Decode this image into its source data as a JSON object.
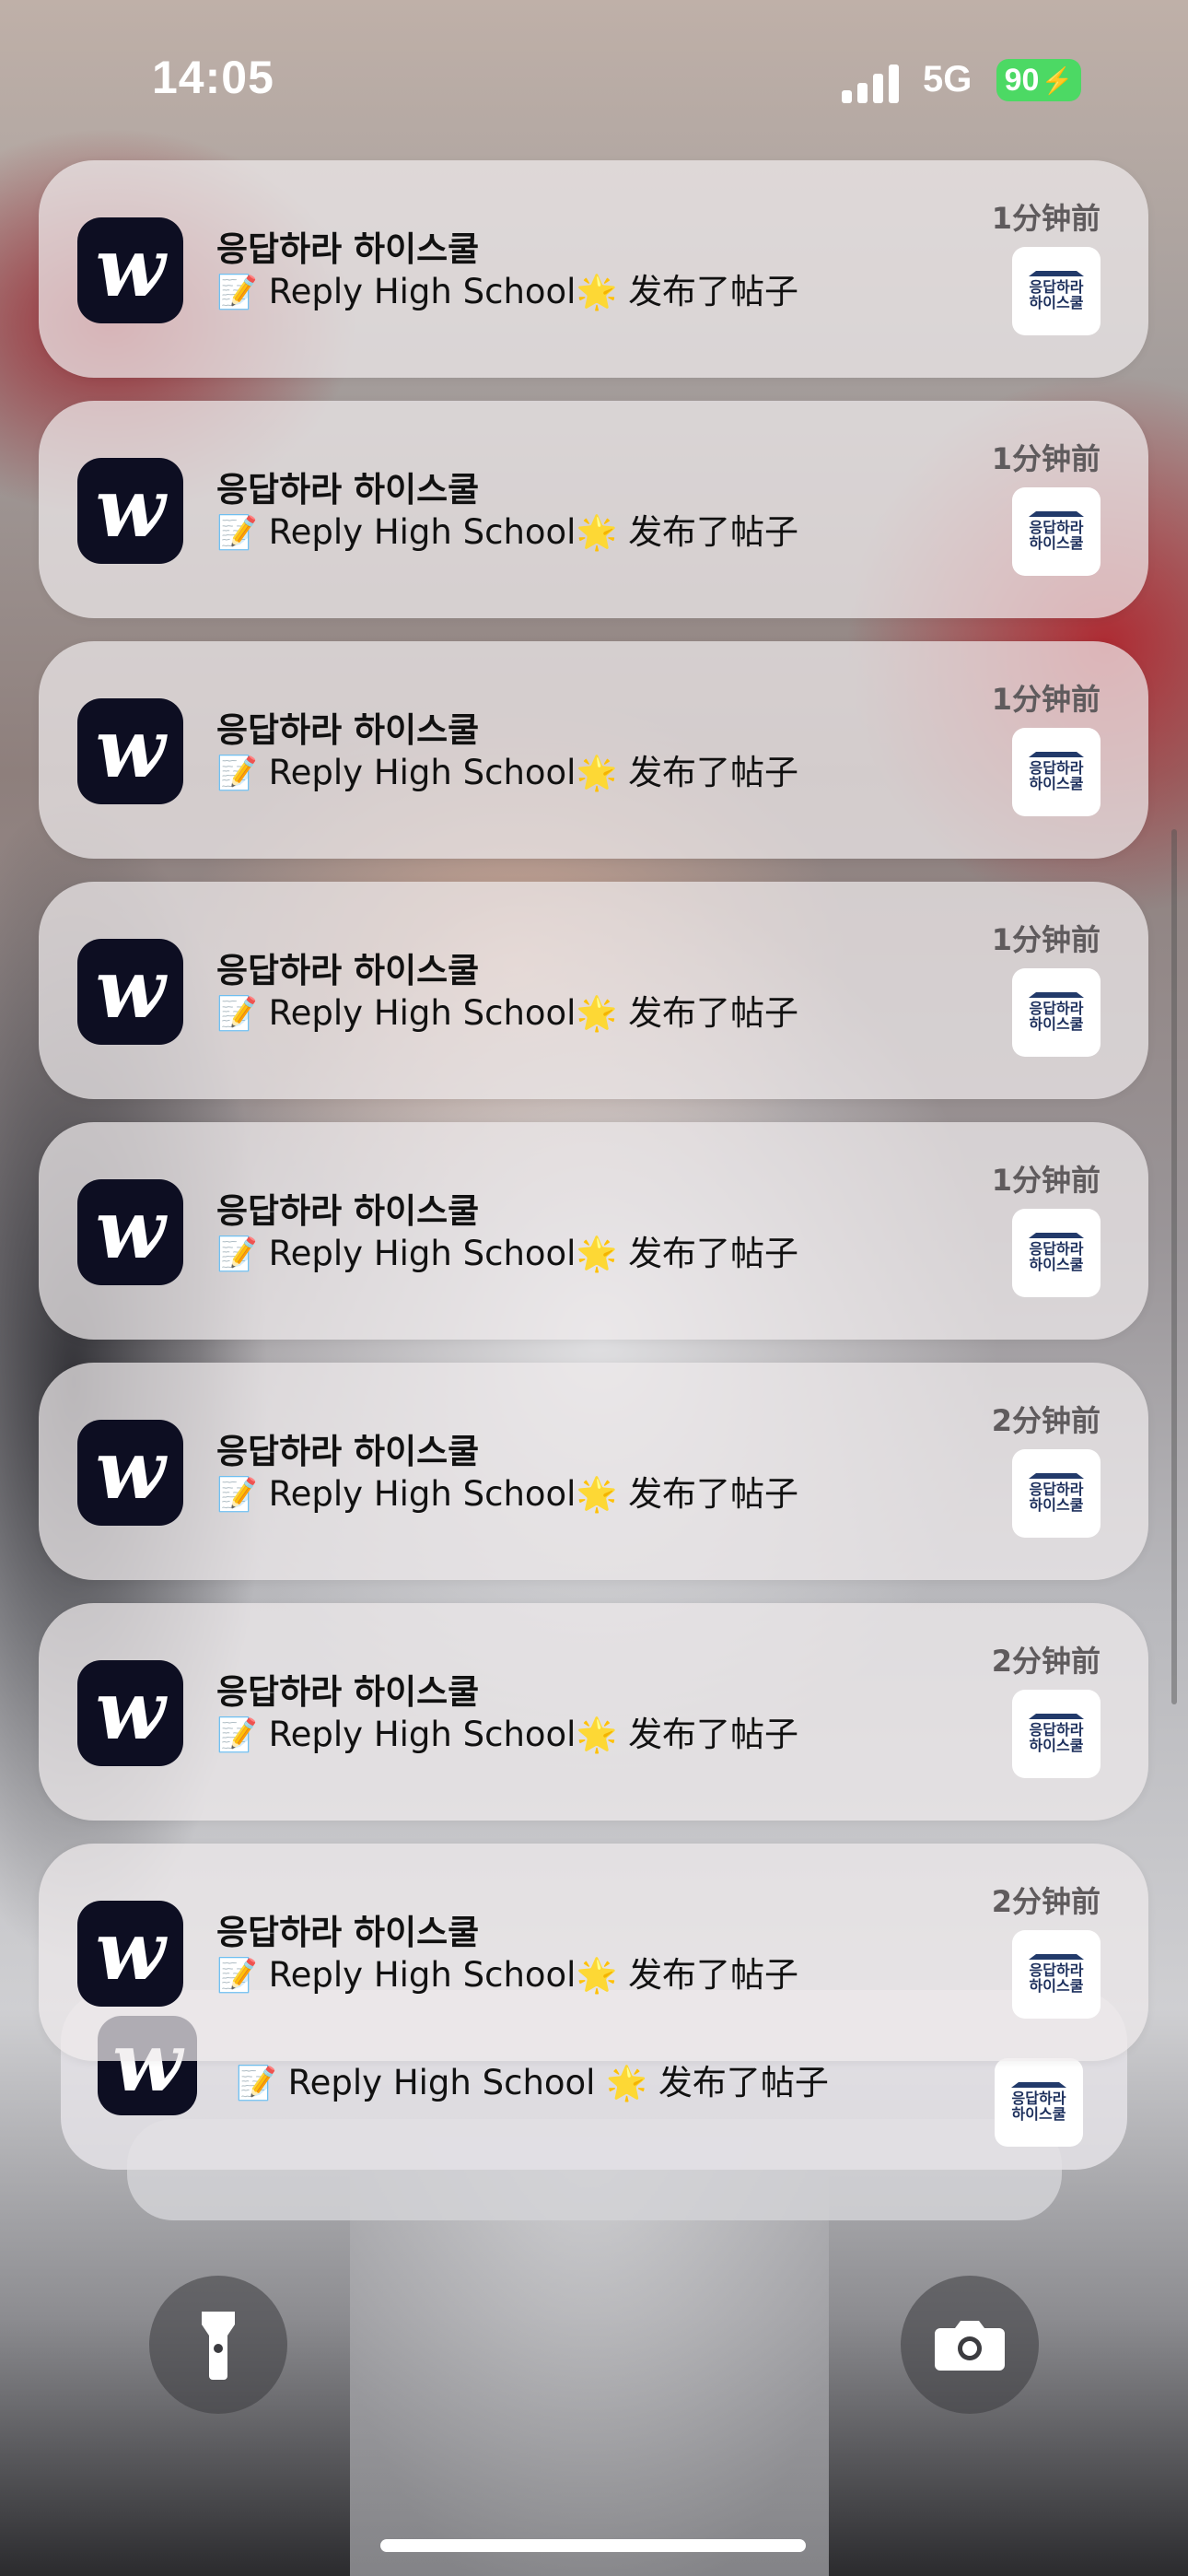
{
  "status_bar": {
    "time": "14:05",
    "network": "5G",
    "battery": "90"
  },
  "notifications": [
    {
      "title": "응답하라 하이스쿨",
      "body": "Reply High School",
      "suffix": "发布了帖子",
      "time": "1分钟前"
    },
    {
      "title": "응답하라 하이스쿨",
      "body": "Reply High School",
      "suffix": "发布了帖子",
      "time": "1分钟前"
    },
    {
      "title": "응답하라 하이스쿨",
      "body": "Reply High School",
      "suffix": "发布了帖子",
      "time": "1分钟前"
    },
    {
      "title": "응답하라 하이스쿨",
      "body": "Reply High School",
      "suffix": "发布了帖子",
      "time": "1分钟前"
    },
    {
      "title": "응답하라 하이스쿨",
      "body": "Reply High School",
      "suffix": "发布了帖子",
      "time": "1分钟前"
    },
    {
      "title": "응답하라 하이스쿨",
      "body": "Reply High School",
      "suffix": "发布了帖子",
      "time": "2分钟前"
    },
    {
      "title": "응답하라 하이스쿨",
      "body": "Reply High School",
      "suffix": "发布了帖子",
      "time": "2分钟前"
    },
    {
      "title": "응답하라 하이스쿨",
      "body": "Reply High School",
      "suffix": "发布了帖子",
      "time": "2分钟前"
    }
  ],
  "stacked_notification": {
    "body": "Reply High School",
    "suffix": "发布了帖子"
  },
  "app_icon_letter": "w",
  "thumbnail": {
    "line1": "응답하라",
    "line2": "하이스쿨"
  },
  "icons": {
    "memo": "memo-emoji",
    "star": "glowing-star-emoji",
    "flashlight": "flashlight-icon",
    "camera": "camera-icon"
  }
}
